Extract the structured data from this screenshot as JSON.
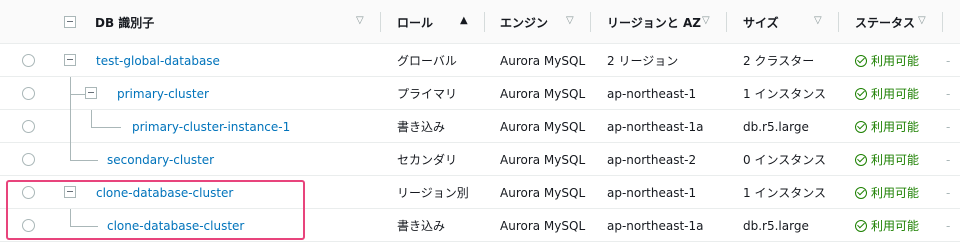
{
  "headers": {
    "db_identifier": "DB 識別子",
    "role": "ロール",
    "engine": "エンジン",
    "region_az": "リージョンと AZ",
    "size": "サイズ",
    "status": "ステータス"
  },
  "rows": [
    {
      "name": "test-global-database",
      "role": "グローバル",
      "engine": "Aurora MySQL",
      "region": "2 リージョン",
      "size": "2 クラスター",
      "status": "利用可能",
      "trail": "-"
    },
    {
      "name": "primary-cluster",
      "role": "プライマリ",
      "engine": "Aurora MySQL",
      "region": "ap-northeast-1",
      "size": "1 インスタンス",
      "status": "利用可能",
      "trail": "-"
    },
    {
      "name": "primary-cluster-instance-1",
      "role": "書き込み",
      "engine": "Aurora MySQL",
      "region": "ap-northeast-1a",
      "size": "db.r5.large",
      "status": "利用可能",
      "trail": "-"
    },
    {
      "name": "secondary-cluster",
      "role": "セカンダリ",
      "engine": "Aurora MySQL",
      "region": "ap-northeast-2",
      "size": "0 インスタンス",
      "status": "利用可能",
      "trail": "-"
    },
    {
      "name": "clone-database-cluster",
      "role": "リージョン別",
      "engine": "Aurora MySQL",
      "region": "ap-northeast-1",
      "size": "1 インスタンス",
      "status": "利用可能",
      "trail": "-"
    },
    {
      "name": "clone-database-cluster",
      "role": "書き込み",
      "engine": "Aurora MySQL",
      "region": "ap-northeast-1a",
      "size": "db.r5.large",
      "status": "利用可能",
      "trail": "-"
    }
  ],
  "icons": {
    "sort_ascending": "triangle-up",
    "sort_default": "triangle-down",
    "status": "check-circle"
  },
  "colors": {
    "link": "#0073bb",
    "status_available": "#1d8102",
    "highlight": "#e8447c"
  }
}
